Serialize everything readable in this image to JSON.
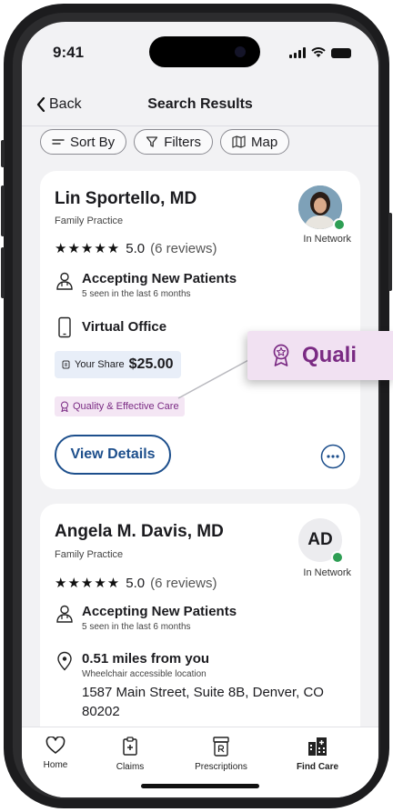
{
  "status_bar": {
    "time": "9:41"
  },
  "nav": {
    "back_label": "Back",
    "title": "Search Results"
  },
  "toolbar": {
    "sort_label": "Sort By",
    "filters_label": "Filters",
    "map_label": "Map"
  },
  "providers": [
    {
      "name": "Lin Sportello, MD",
      "specialty": "Family Practice",
      "stars": "★★★★★",
      "rating": "5.0",
      "reviews": "(6 reviews)",
      "network": "In Network",
      "accepting": "Accepting New Patients",
      "seen": "5 seen in the last 6 months",
      "office": "Virtual Office",
      "share_label": "Your Share",
      "share_value": "$25.00",
      "quality": "Quality & Effective Care",
      "details_label": "View Details"
    },
    {
      "name": "Angela M. Davis, MD",
      "specialty": "Family Practice",
      "initials": "AD",
      "stars": "★★★★★",
      "rating": "5.0",
      "reviews": "(6 reviews)",
      "network": "In Network",
      "accepting": "Accepting New Patients",
      "seen": "5 seen in the last 6 months",
      "distance": "0.51 miles from you",
      "accessibility": "Wheelchair accessible location",
      "address": "1587 Main Street, Suite 8B, Denver, CO 80202"
    }
  ],
  "tabbar": {
    "home": "Home",
    "claims": "Claims",
    "prescriptions": "Prescriptions",
    "find_care": "Find Care",
    "active": "find_care"
  },
  "callout": {
    "text": "Quali"
  },
  "colors": {
    "accent": "#1d4f8c",
    "quality": "#7a2a83",
    "network_check": "#2e9e54"
  }
}
